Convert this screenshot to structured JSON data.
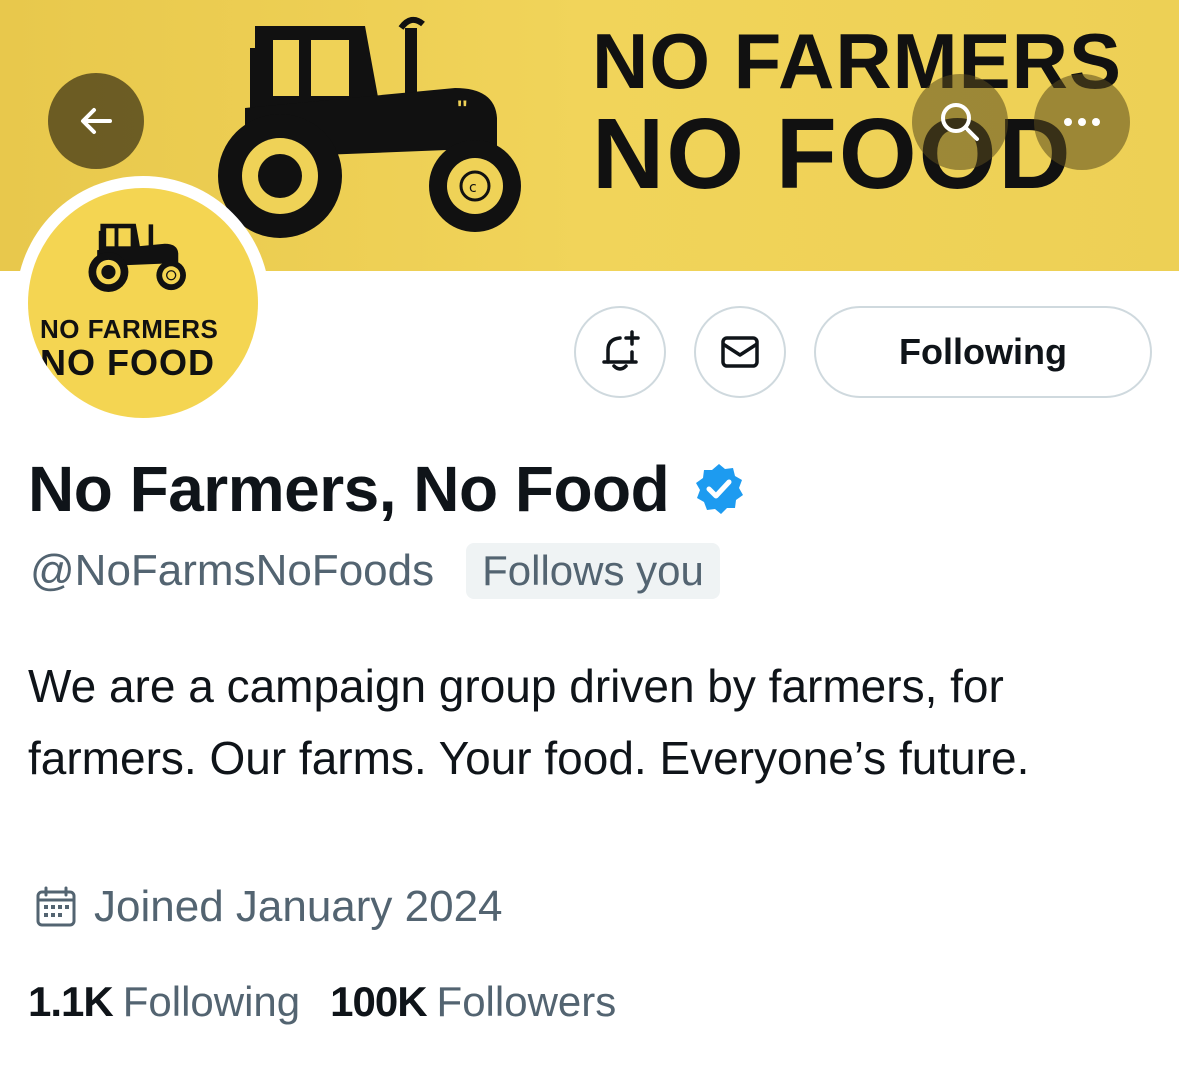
{
  "banner": {
    "line1": "NO FARMERS",
    "line2": "NO FOOD",
    "color": "#efd257"
  },
  "avatar": {
    "line1": "NO FARMERS",
    "line2": "NO FOOD"
  },
  "header_buttons": {
    "back_icon": "arrow-left-icon",
    "search_icon": "search-icon",
    "more_icon": "more-horizontal-icon"
  },
  "actions": {
    "notify_icon": "bell-plus-icon",
    "message_icon": "envelope-icon",
    "following_label": "Following"
  },
  "profile": {
    "display_name": "No Farmers, No Food",
    "verified_color": "#1d9bf0",
    "handle": "@NoFarmsNoFoods",
    "follows_you": "Follows you",
    "bio": "We are a campaign group driven by farmers, for farmers. Our farms. Your food. Everyone’s future.",
    "joined": "Joined January 2024"
  },
  "stats": {
    "following_count": "1.1K",
    "following_label": "Following",
    "followers_count": "100K",
    "followers_label": "Followers"
  }
}
